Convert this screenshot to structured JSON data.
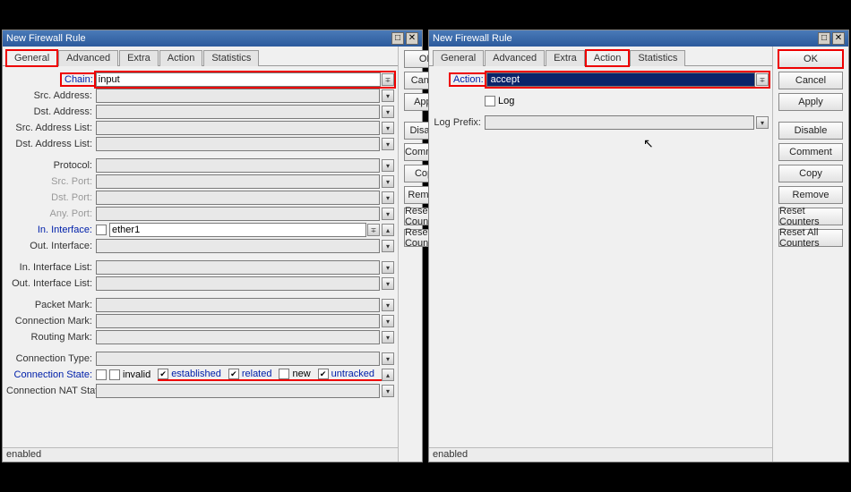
{
  "window1": {
    "title": "New Firewall Rule",
    "tabs": [
      "General",
      "Advanced",
      "Extra",
      "Action",
      "Statistics"
    ],
    "activeTab": 0,
    "highlightTab": 0,
    "labels": {
      "chain": "Chain:",
      "srcAddr": "Src. Address:",
      "dstAddr": "Dst. Address:",
      "srcAddrList": "Src. Address List:",
      "dstAddrList": "Dst. Address List:",
      "protocol": "Protocol:",
      "srcPort": "Src. Port:",
      "dstPort": "Dst. Port:",
      "anyPort": "Any. Port:",
      "inIf": "In. Interface:",
      "outIf": "Out. Interface:",
      "inIfList": "In. Interface List:",
      "outIfList": "Out. Interface List:",
      "pktMark": "Packet Mark:",
      "connMark": "Connection Mark:",
      "routeMark": "Routing Mark:",
      "connType": "Connection Type:",
      "connState": "Connection State:",
      "connNat": "Connection NAT State:"
    },
    "values": {
      "chain": "input",
      "inIf": "ether1"
    },
    "connState": {
      "invalid": "invalid",
      "established": "established",
      "related": "related",
      "new": "new",
      "untracked": "untracked",
      "chk_invalid": false,
      "chk_established": true,
      "chk_related": true,
      "chk_new": false,
      "chk_untracked": true
    },
    "buttons": [
      "OK",
      "Cancel",
      "Apply",
      "Disable",
      "Comment",
      "Copy",
      "Remove",
      "Reset Counters",
      "Reset All Counters"
    ],
    "status": "enabled"
  },
  "window2": {
    "title": "New Firewall Rule",
    "tabs": [
      "General",
      "Advanced",
      "Extra",
      "Action",
      "Statistics"
    ],
    "activeTab": 3,
    "highlightTab": 3,
    "labels": {
      "action": "Action:",
      "log": "Log",
      "logPrefix": "Log Prefix:"
    },
    "values": {
      "action": "accept"
    },
    "buttons": [
      "OK",
      "Cancel",
      "Apply",
      "Disable",
      "Comment",
      "Copy",
      "Remove",
      "Reset Counters",
      "Reset All Counters"
    ],
    "okHighlight": true,
    "status": "enabled"
  }
}
